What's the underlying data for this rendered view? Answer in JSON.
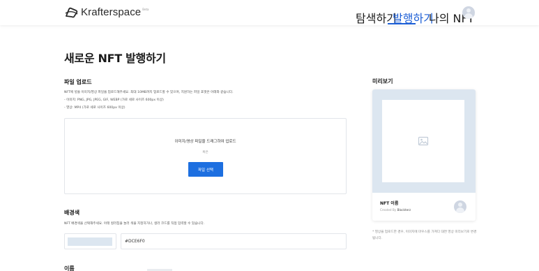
{
  "header": {
    "logo_text": "Krafterspace",
    "logo_badge": "Beta",
    "nav": [
      {
        "label": "탐색하기",
        "active": false
      },
      {
        "label": "발행하기",
        "active": true
      },
      {
        "label": "나의 NFT",
        "active": false
      }
    ]
  },
  "page": {
    "title": "새로운 NFT 발행하기"
  },
  "upload": {
    "title": "파일 업로드",
    "desc_line1": "NFT에 넣을 이미지/영상 파일을 업로드해주세요. 최대 10MB까지 업로드할 수 있으며, 지원하는 파일 포맷은 아래와 같습니다.",
    "desc_line2": "- 이미지: PNG, JPG, JPEG, GIF, WEBP (가로 세로 사이즈 600px 이상)",
    "desc_line3": "- 영상: MP4 (가로 세로 사이즈 600px 이상)",
    "dropzone_text": "이미지/영상 파일을 드래그하여 업로드",
    "or_text": "혹은",
    "select_button": "파일 선택"
  },
  "background": {
    "title": "배경색",
    "desc": "NFT 배경색을 선택해주세요. 아래 컬러칩을 눌러 색을 지정하거나, 컬러 코드를 직접 입력할 수 있습니다.",
    "color_value": "#DCE6F0"
  },
  "name_section": {
    "title": "이름"
  },
  "preview": {
    "title": "미리보기",
    "nft_name": "NFT 이름",
    "created_by_label": "Created By",
    "creator": "Blockterz",
    "note": "* 영상을 업로드한 경우, 이미지에 마우스를 가져다 대면 영상 미리보기로 변경됩니다."
  },
  "colors": {
    "accent": "#1d6fe0",
    "preview_bg": "#DCE6F0"
  }
}
